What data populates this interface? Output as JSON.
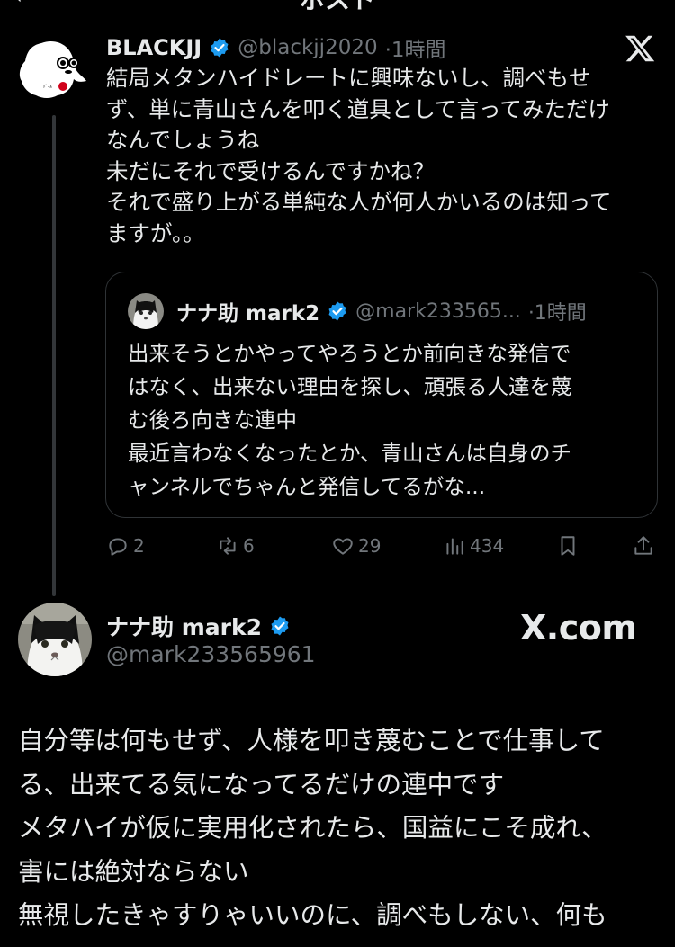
{
  "header": {
    "back_icon": "chevron-left-icon",
    "title": "ポスト"
  },
  "reply_parent": {
    "name": "BLACKJJ",
    "handle": "@blackjj2020",
    "time": "·1時間",
    "lines": [
      "結局メタンハイドレートに興味ないし、調べもせ",
      "ず、単に青山さんを叩く道具として言ってみただけ",
      "なんでしょうね",
      "未だにそれで受けるんですかね？",
      "それで盛り上がる単純な人が何人かいるのは知って",
      "ますが。。"
    ],
    "quote": {
      "name": "ナナ助 mark2",
      "handle": "@mark233565...",
      "time": "·1時間",
      "lines": [
        "出来そうとかやってやろうとか前向きな発信で",
        "はなく、出来ない理由を探し、頑張る人達を蔑",
        "む後ろ向きな連中",
        "最近言わなくなったとか、青山さんは自身のチ",
        "ャンネルでちゃんと発信してるがな..."
      ]
    },
    "actions": {
      "replies": "2",
      "reposts": "6",
      "likes": "29",
      "views": "434"
    }
  },
  "main_tweet": {
    "name": "ナナ助 mark2",
    "handle": "@mark233565961",
    "watermark": "X.com",
    "lines": [
      "自分等は何もせず、人様を叩き蔑むことで仕事して",
      "る、出来てる気になってるだけの連中です",
      "メタハイが仮に実用化されたら、国益にこそ成れ、",
      "害には絶対ならない",
      "無視したきゃすりゃいいのに、調べもしない、何も"
    ]
  },
  "colors": {
    "background": "#000000",
    "text": "#e7e9ea",
    "muted": "#71767b",
    "verified": "#1d9bf0",
    "border": "#2f3336"
  }
}
